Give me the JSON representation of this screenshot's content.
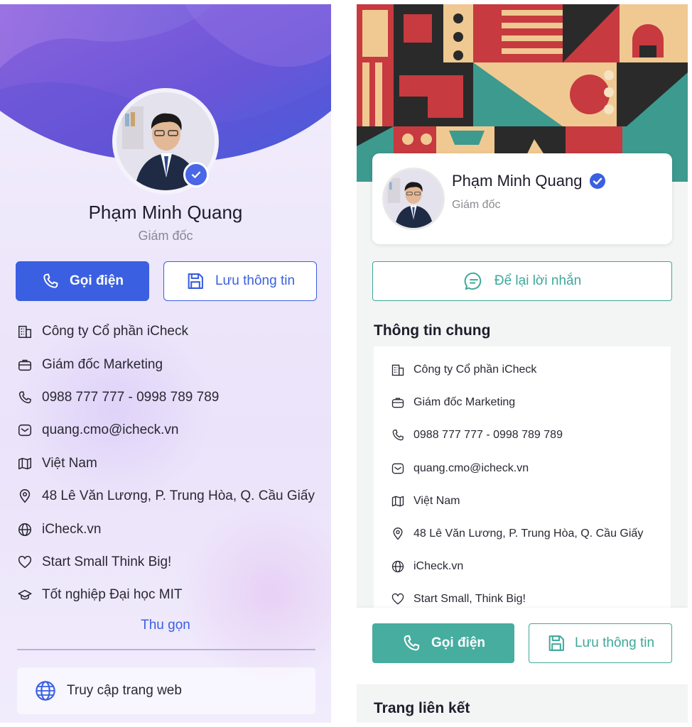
{
  "colors": {
    "left_accent": "#3a5fe0",
    "verify_badge": "#4a67e6",
    "right_accent": "#46ad9f",
    "right_outline": "#3ea89a",
    "text_dark": "#1d1d2b",
    "text_muted": "#8a8796"
  },
  "left_card": {
    "name": "Phạm Minh Quang",
    "role": "Giám đốc",
    "call_label": "Gọi điện",
    "save_label": "Lưu thông tin",
    "info": [
      {
        "icon": "building-icon",
        "text": "Công ty Cổ phần iCheck"
      },
      {
        "icon": "briefcase-icon",
        "text": "Giám đốc Marketing"
      },
      {
        "icon": "phone-icon",
        "text": "0988 777 777 - 0998 789 789"
      },
      {
        "icon": "email-icon",
        "text": "quang.cmo@icheck.vn"
      },
      {
        "icon": "map-icon",
        "text": "Việt Nam"
      },
      {
        "icon": "location-pin-icon",
        "text": "48 Lê Văn Lương, P. Trung Hòa, Q. Cầu Giấy"
      },
      {
        "icon": "globe-icon",
        "text": "iCheck.vn"
      },
      {
        "icon": "heart-icon",
        "text": "Start Small Think Big!"
      },
      {
        "icon": "graduation-cap-icon",
        "text": "Tốt nghiệp Đại học MIT"
      }
    ],
    "collapse_label": "Thu gọn",
    "web_label": "Truy cập trang web"
  },
  "right_card": {
    "name": "Phạm Minh Quang",
    "role": "Giám đốc",
    "message_label": "Để lại lời nhắn",
    "section_title": "Thông tin chung",
    "info": [
      {
        "icon": "building-icon",
        "text": "Công ty Cổ phần iCheck"
      },
      {
        "icon": "briefcase-icon",
        "text": "Giám đốc Marketing"
      },
      {
        "icon": "phone-icon",
        "text": "0988 777 777 - 0998 789 789"
      },
      {
        "icon": "email-icon",
        "text": "quang.cmo@icheck.vn"
      },
      {
        "icon": "map-icon",
        "text": "Việt Nam"
      },
      {
        "icon": "location-pin-icon",
        "text": "48 Lê Văn Lương, P. Trung Hòa, Q. Cầu Giấy"
      },
      {
        "icon": "globe-icon",
        "text": "iCheck.vn"
      },
      {
        "icon": "heart-icon",
        "text": "Start Small, Think Big!"
      }
    ],
    "call_label": "Gọi điện",
    "save_label": "Lưu thông tin",
    "links_title": "Trang liên kết"
  }
}
